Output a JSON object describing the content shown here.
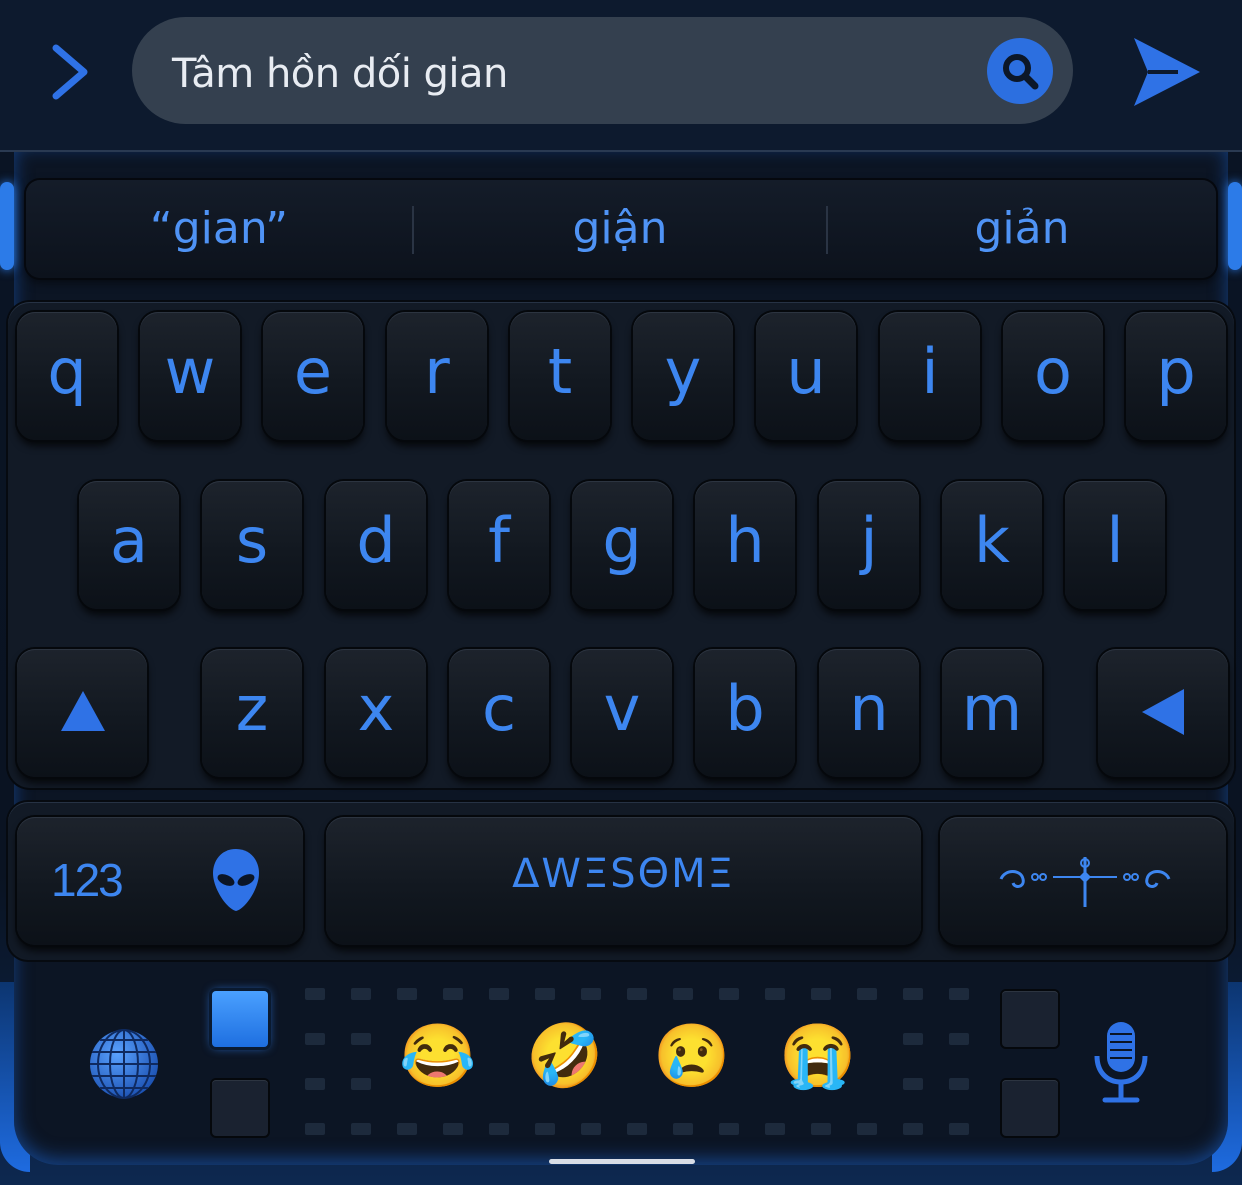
{
  "top_bar": {
    "back_icon": "chevron-right-icon",
    "search_text": "Tâm hồn dối gian",
    "search_icon": "magnifier-icon",
    "send_icon": "paper-plane-icon"
  },
  "suggestions": [
    "“gian”",
    "giận",
    "giản"
  ],
  "keys": {
    "row1": [
      "q",
      "w",
      "e",
      "r",
      "t",
      "y",
      "u",
      "i",
      "o",
      "p"
    ],
    "row2": [
      "a",
      "s",
      "d",
      "f",
      "g",
      "h",
      "j",
      "k",
      "l"
    ],
    "row3": [
      "z",
      "x",
      "c",
      "v",
      "b",
      "n",
      "m"
    ],
    "shift_icon": "shift-up-triangle-icon",
    "delete_icon": "backspace-left-triangle-icon"
  },
  "bottom_row": {
    "numbers_label": "123",
    "alien_icon": "alien-head-icon",
    "space_label": "ΔWΞSΘMΞ",
    "ornament_icon": "ornament-flourish-icon"
  },
  "emoji_strip": {
    "globe_icon": "globe-icon",
    "emojis": [
      "😂",
      "🤣",
      "😢",
      "😭"
    ],
    "mic_icon": "microphone-icon"
  },
  "colors": {
    "accent": "#3d86f0",
    "search_bg": "#34404f",
    "search_button": "#2c6fe0",
    "background": "#0b1526"
  }
}
